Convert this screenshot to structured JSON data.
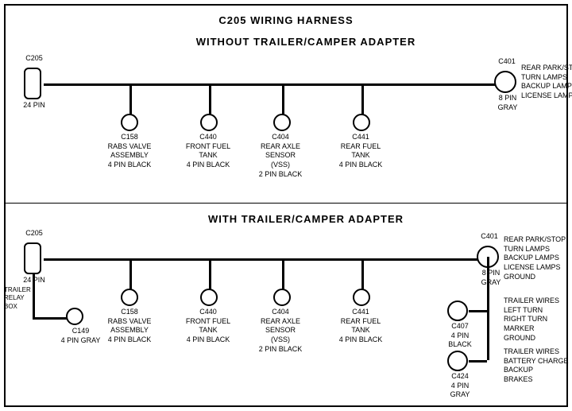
{
  "title": "C205 WIRING HARNESS",
  "section1": {
    "label": "WITHOUT  TRAILER/CAMPER ADAPTER",
    "connectors": [
      {
        "id": "C205_1",
        "label": "C205\n24 PIN"
      },
      {
        "id": "C401_1",
        "label": "C401\n8 PIN\nGRAY"
      },
      {
        "id": "C158_1",
        "label": "C158\nRABS VALVE\nASSEMBLY\n4 PIN BLACK"
      },
      {
        "id": "C440_1",
        "label": "C440\nFRONT FUEL\nTANK\n4 PIN BLACK"
      },
      {
        "id": "C404_1",
        "label": "C404\nREAR AXLE\nSENSOR\n(VSS)\n2 PIN BLACK"
      },
      {
        "id": "C441_1",
        "label": "C441\nREAR FUEL\nTANK\n4 PIN BLACK"
      }
    ],
    "right_label": "REAR PARK/STOP\nTURN LAMPS\nBACKUP LAMPS\nLICENSE LAMPS"
  },
  "section2": {
    "label": "WITH  TRAILER/CAMPER ADAPTER",
    "connectors": [
      {
        "id": "C205_2",
        "label": "C205\n24 PIN"
      },
      {
        "id": "C401_2",
        "label": "C401\n8 PIN\nGRAY"
      },
      {
        "id": "C158_2",
        "label": "C158\nRABS VALVE\nASSEMBLY\n4 PIN BLACK"
      },
      {
        "id": "C440_2",
        "label": "C440\nFRONT FUEL\nTANK\n4 PIN BLACK"
      },
      {
        "id": "C404_2",
        "label": "C404\nREAR AXLE\nSENSOR\n(VSS)\n2 PIN BLACK"
      },
      {
        "id": "C441_2",
        "label": "C441\nREAR FUEL\nTANK\n4 PIN BLACK"
      },
      {
        "id": "C149",
        "label": "C149\n4 PIN GRAY"
      },
      {
        "id": "C407",
        "label": "C407\n4 PIN\nBLACK"
      },
      {
        "id": "C424",
        "label": "C424\n4 PIN\nGRAY"
      }
    ],
    "right_labels": [
      "REAR PARK/STOP\nTURN LAMPS\nBACKUP LAMPS\nLICENSE LAMPS\nGROUND",
      "TRAILER WIRES\nLEFT TURN\nRIGHT TURN\nMARKER\nGROUND",
      "TRAILER WIRES\nBATTERY CHARGE\nBACKUP\nBRAKES"
    ],
    "trailer_relay": "TRAILER\nRELAY\nBOX"
  }
}
